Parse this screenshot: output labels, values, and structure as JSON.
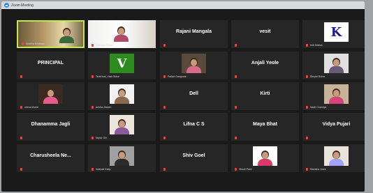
{
  "window": {
    "title": "Zoom Meeting"
  },
  "participants": [
    {
      "name": "Shobha Krishnan",
      "display": "video",
      "active": true
    },
    {
      "name": "Sowmya Sriram",
      "display": "video"
    },
    {
      "name": "Rajani Mangala",
      "display": "name"
    },
    {
      "name": "vesit",
      "display": "name"
    },
    {
      "name": "Kriti Mishra",
      "display": "avatar",
      "avatar_letter": "K"
    },
    {
      "name": "PRINCIPAL",
      "display": "name"
    },
    {
      "name": "TechHost_Yash Bhise",
      "display": "avatar",
      "avatar_letter": "V"
    },
    {
      "name": "Pallavi Gangurde",
      "display": "photo"
    },
    {
      "name": "Anjali Yeole",
      "display": "name"
    },
    {
      "name": "Dimple Bohra",
      "display": "photo"
    },
    {
      "name": "veena trivedi",
      "display": "photo"
    },
    {
      "name": "Amrita Jhaveri",
      "display": "photo"
    },
    {
      "name": "Dell",
      "display": "name"
    },
    {
      "name": "Kirti",
      "display": "name"
    },
    {
      "name": "Nadir Charniya",
      "display": "photo"
    },
    {
      "name": "Dhanamma Jagli",
      "display": "name"
    },
    {
      "name": "Nupur Giri",
      "display": "photo"
    },
    {
      "name": "Lifna C S",
      "display": "name"
    },
    {
      "name": "Maya Bhat",
      "display": "name"
    },
    {
      "name": "Vidya Pujari",
      "display": "name"
    },
    {
      "name": "Charusheela Ne...",
      "display": "name"
    },
    {
      "name": "Vaishali Gatty",
      "display": "photo"
    },
    {
      "name": "Shiv Goel",
      "display": "name"
    },
    {
      "name": "Himali Patel",
      "display": "photo"
    },
    {
      "name": "Manisha Joshi",
      "display": "photo"
    }
  ],
  "colors": {
    "active_border": "#c6e84a",
    "tile_bg": "#262626",
    "muted_mic": "#ff3b3b",
    "avatar_k_bg": "#ffffff",
    "avatar_k_fg": "#1a1a8c",
    "avatar_v_bg": "#2e8b1e",
    "avatar_v_fg": "#ffffff"
  }
}
